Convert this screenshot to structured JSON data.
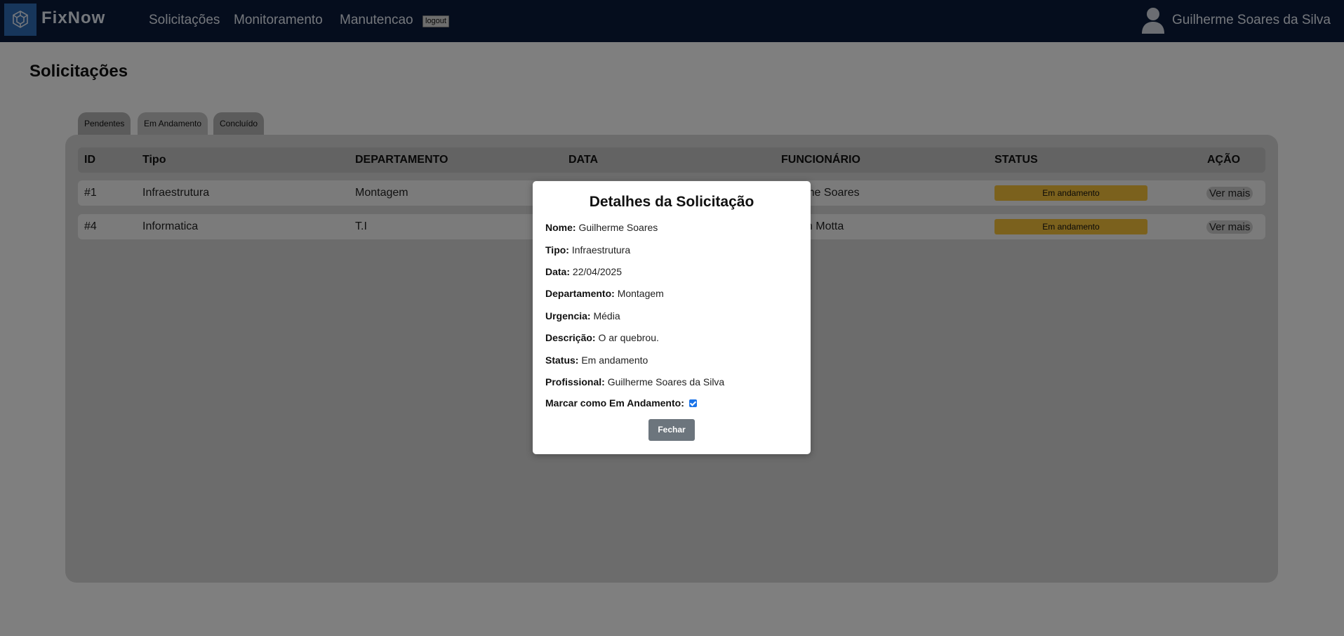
{
  "nav": {
    "brand": "FixNow",
    "links": [
      "Solicitações",
      "Monitoramento",
      "Manutencao"
    ],
    "logout": "logout",
    "user": "Guilherme Soares da Silva",
    "bg_color": "#0b1a3a"
  },
  "page": {
    "title": "Solicitações"
  },
  "tabs": [
    "Pendentes",
    "Em Andamento",
    "Concluído"
  ],
  "table": {
    "headers": [
      "ID",
      "Tipo",
      "DEPARTAMENTO",
      "DATA",
      "FUNCIONÁRIO",
      "STATUS",
      "AÇÃO"
    ],
    "rows": [
      {
        "id": "#1",
        "tipo": "Infraestrutura",
        "departamento": "Montagem",
        "funcionario": "erme Soares",
        "status": "Em andamento",
        "acao": "Ver mais"
      },
      {
        "id": "#4",
        "tipo": "Informatica",
        "departamento": "T.I",
        "funcionario": "an Motta",
        "status": "Em andamento",
        "acao": "Ver mais"
      }
    ]
  },
  "modal": {
    "title": "Detalhes da Solicitação",
    "fields": [
      {
        "label": "Nome:",
        "value": "Guilherme Soares"
      },
      {
        "label": "Tipo:",
        "value": "Infraestrutura"
      },
      {
        "label": "Data:",
        "value": "22/04/2025"
      },
      {
        "label": "Departamento:",
        "value": "Montagem"
      },
      {
        "label": "Urgencia:",
        "value": "Média"
      },
      {
        "label": "Descrição:",
        "value": "O ar quebrou."
      },
      {
        "label": "Status:",
        "value": "Em andamento"
      },
      {
        "label": "Profissional:",
        "value": "Guilherme Soares da Silva"
      }
    ],
    "checkbox_label": "Marcar como Em Andamento:",
    "checkbox_checked": true,
    "close_label": "Fechar"
  },
  "colors": {
    "status_badge": "#f6c33a",
    "close_button": "#6c757d",
    "logo_bg": "#2f6db6",
    "checkbox": "#1a73e8"
  }
}
